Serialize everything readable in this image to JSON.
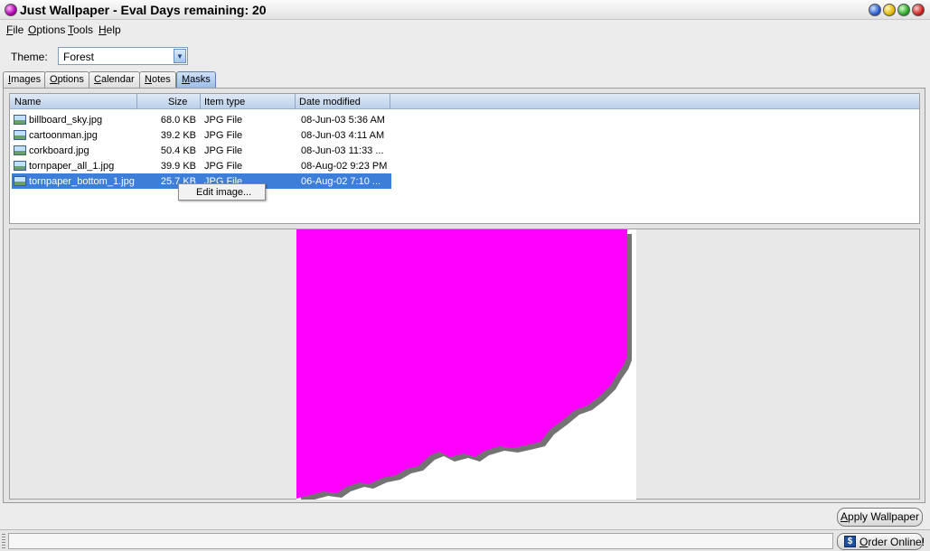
{
  "window": {
    "title": "Just Wallpaper - Eval Days remaining: 20"
  },
  "menu": [
    "File",
    "Options",
    "Tools",
    "Help"
  ],
  "theme": {
    "label": "Theme:",
    "value": "Forest"
  },
  "tabs": [
    {
      "label": "Images",
      "active": false
    },
    {
      "label": "Options",
      "active": false
    },
    {
      "label": "Calendar",
      "active": false
    },
    {
      "label": "Notes",
      "active": false
    },
    {
      "label": "Masks",
      "active": true
    }
  ],
  "file_list": {
    "columns": [
      "Name",
      "Size",
      "Item type",
      "Date modified"
    ],
    "rows": [
      {
        "name": "billboard_sky.jpg",
        "size": "68.0 KB",
        "type": "JPG File",
        "date": "08-Jun-03 5:36 AM"
      },
      {
        "name": "cartoonman.jpg",
        "size": "39.2 KB",
        "type": "JPG File",
        "date": "08-Jun-03 4:11 AM"
      },
      {
        "name": "corkboard.jpg",
        "size": "50.4 KB",
        "type": "JPG File",
        "date": "08-Jun-03 11:33 ..."
      },
      {
        "name": "tornpaper_all_1.jpg",
        "size": "39.9 KB",
        "type": "JPG File",
        "date": "08-Aug-02 9:23 PM"
      },
      {
        "name": "tornpaper_bottom_1.jpg",
        "size": "25.7 KB",
        "type": "JPG File",
        "date": "06-Aug-02 7:10 ...",
        "selected": true
      }
    ]
  },
  "context_menu": {
    "items": [
      "Edit image..."
    ]
  },
  "preview": {
    "mask_color": "#ff00ff",
    "background": "#ffffff"
  },
  "buttons": {
    "apply": "Apply Wallpaper",
    "order": "Order Online!"
  },
  "icons": {
    "app": "app-orb-icon",
    "file": "image-file-icon",
    "order": "dollar-icon"
  }
}
